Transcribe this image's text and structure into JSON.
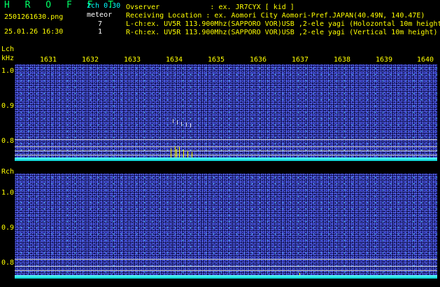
{
  "header": {
    "title": "H R O F F T",
    "mode": "2ch 0.30",
    "filename": "2501261630.png",
    "meteor_label": "meteor",
    "count_l": "7",
    "count_r": "1",
    "datetime": "25.01.26 16:30",
    "observer": "Ovserver            : ex. JR7CYX [ kid ]",
    "location": "Receiving Location : ex. Aomori City Aomori-Pref.JAPAN(40.49N, 140.47E)",
    "lch_info": "L-ch:ex. UV5R 113.900Mhz(SAPPORO VOR)USB ,2-ele yagi (Holozontal 10m height)",
    "rch_info": "R-ch:ex. UV5R 113.900Mhz(SAPPORO VOR)USB ,2-ele yagi (Vertical 10m height)"
  },
  "axis": {
    "lch_label": "Lch",
    "unit": "kHz",
    "rch_label": "Rch",
    "freq_ticks": [
      "1631",
      "1632",
      "1633",
      "1634",
      "1635",
      "1636",
      "1637",
      "1638",
      "1639",
      "1640"
    ],
    "l_scale": [
      "1.0",
      "0.9",
      "0.8"
    ],
    "r_scale": [
      "1.0",
      "0.9",
      "0.8"
    ]
  },
  "colors": {
    "background": "#000000",
    "label": "#ffff00",
    "waterfall": "#0a0a4a",
    "floor": "#00ffff",
    "meteor": "#ffff00"
  }
}
